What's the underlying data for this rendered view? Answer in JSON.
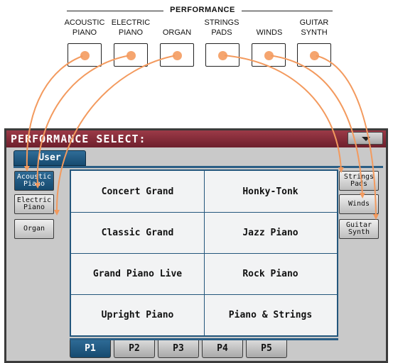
{
  "panel": {
    "title": "PERFORMANCE",
    "buttons": [
      {
        "label": "ACOUSTIC\nPIANO"
      },
      {
        "label": "ELECTRIC\nPIANO"
      },
      {
        "label": "ORGAN"
      },
      {
        "label": "STRINGS\nPADS"
      },
      {
        "label": "WINDS"
      },
      {
        "label": "GUITAR\nSYNTH"
      }
    ],
    "led_color": "#f5a56f"
  },
  "display": {
    "title": "PERFORMANCE SELECT:",
    "bank_tab": "User",
    "left_buttons": [
      {
        "label": "Acoustic\nPiano",
        "active": true
      },
      {
        "label": "Electric\nPiano",
        "active": false
      },
      {
        "label": "Organ",
        "active": false
      }
    ],
    "right_buttons": [
      {
        "label": "Strings\nPads"
      },
      {
        "label": "Winds"
      },
      {
        "label": "Guitar\nSynth"
      }
    ],
    "performances": [
      [
        "Concert Grand",
        "Honky-Tonk"
      ],
      [
        "Classic Grand",
        "Jazz Piano"
      ],
      [
        "Grand Piano Live",
        "Rock Piano"
      ],
      [
        "Upright Piano",
        "Piano & Strings"
      ]
    ],
    "pages": [
      "P1",
      "P2",
      "P3",
      "P4",
      "P5"
    ],
    "active_page": "P1",
    "colors": {
      "title_bar": "#8a2e3b",
      "selection": "#1f5a85",
      "arrow": "#f39a5e"
    }
  }
}
